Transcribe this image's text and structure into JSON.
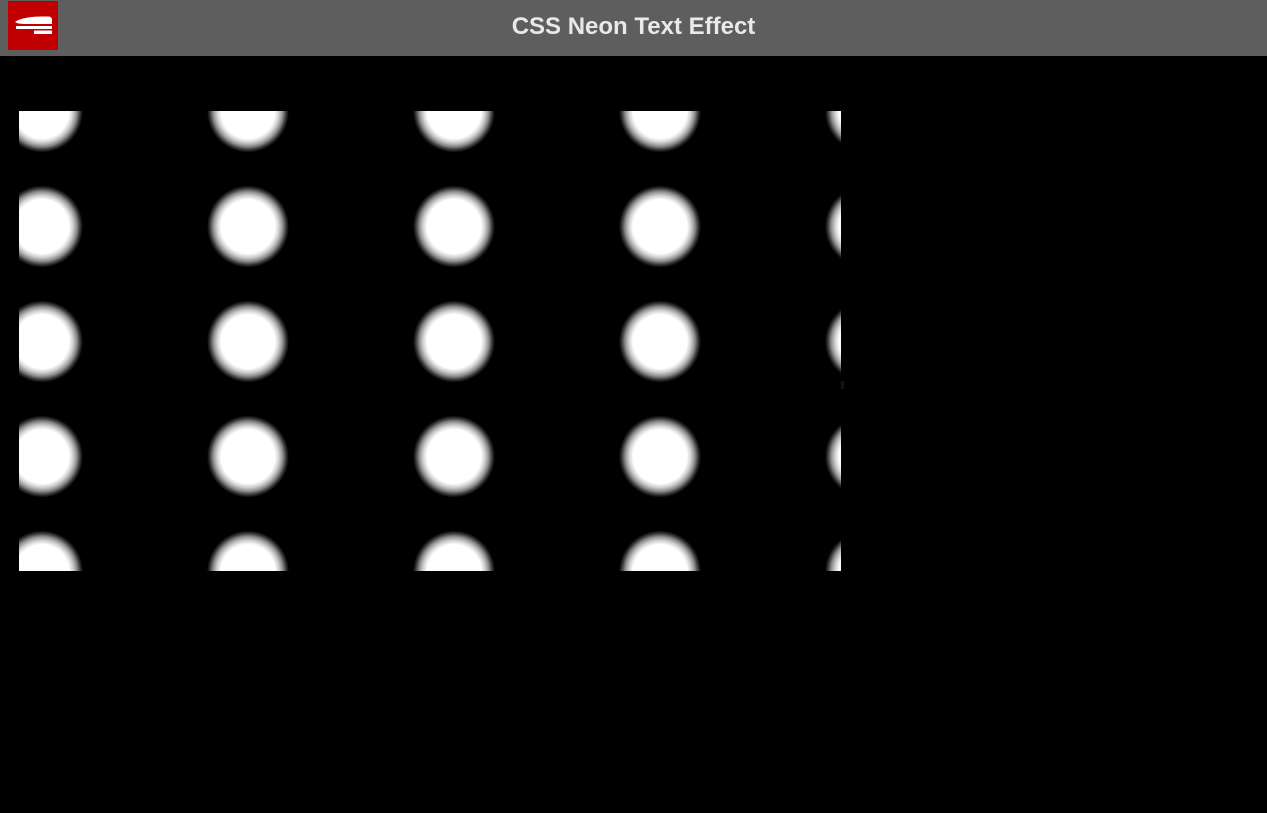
{
  "header": {
    "title": "CSS Neon Text Effect",
    "logo_icon": "stapler-icon"
  },
  "colors": {
    "header_background": "#5e5e5e",
    "logo_background": "#c00000",
    "title_text": "#e9e9e9",
    "page_background": "#000000",
    "glow": "#ffffff"
  },
  "demo": {
    "pattern_icon": "glowing-dot-grid"
  }
}
